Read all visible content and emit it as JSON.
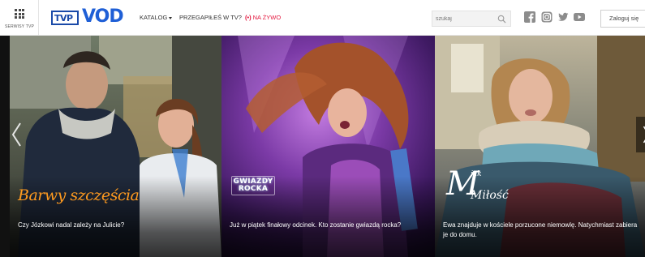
{
  "header": {
    "services_label": "SERWISY TVP",
    "logo_tvp": "TVP",
    "logo_vod": "VOD",
    "nav": {
      "katalog": "KATALOG",
      "przegapiles": "PRZEGAPIŁEŚ W TV?",
      "na_zywo_icon": "(•)",
      "na_zywo": "NA ŻYWO"
    },
    "search": {
      "placeholder": "szukaj"
    },
    "social_icons": [
      "facebook-icon",
      "instagram-icon",
      "twitter-icon",
      "youtube-icon"
    ],
    "login_label": "Zaloguj się"
  },
  "colors": {
    "brand_blue": "#1f5fd6",
    "live_red": "#e3163d",
    "barwy_orange": "#ff9a1f"
  },
  "carousel": {
    "slides": [
      {
        "title_art": "Barwy szczęścia",
        "caption": "Czy Józkowi nadal zależy na Julicie?"
      },
      {
        "title_art_line1": "GWIAZDY",
        "title_art_line2": "ROCKA",
        "caption": "Już w piątek finałowy odcinek. Kto zostanie gwiazdą rocka?"
      },
      {
        "title_art_m": "M",
        "title_art_jak": "jak",
        "title_art_milosc": "Miłość",
        "caption": "Ewa znajduje w kościele porzucone niemowlę. Natychmiast zabiera je do domu."
      }
    ]
  }
}
